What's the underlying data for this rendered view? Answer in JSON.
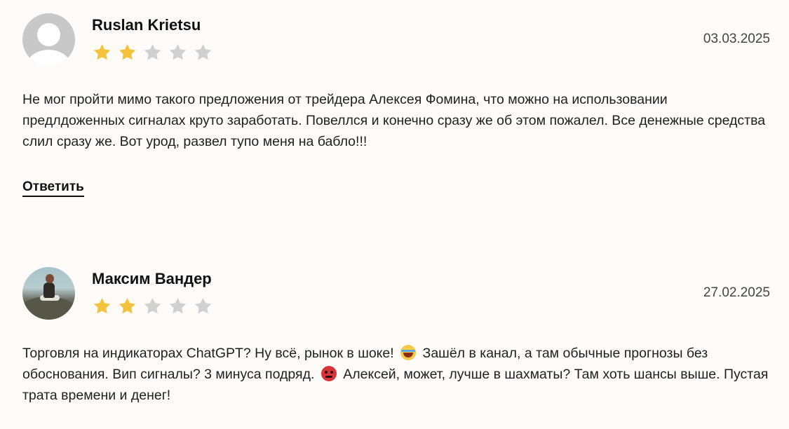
{
  "reviews": [
    {
      "author": "Ruslan Krietsu",
      "avatar": "default-user-avatar",
      "rating": 2,
      "max_rating": 5,
      "date": "03.03.2025",
      "text": "Не мог пройти мимо такого предложения от трейдера Алексея Фомина, что можно на использовании предлдоженных сигналах круто заработать. Повеллся и конечно сразу же об этом пожалел. Все денежные средства слил сразу же. Вот урод, развел тупо меня на бабло!!!",
      "reply_label": "Ответить"
    },
    {
      "author": "Максим Вандер",
      "avatar": "photo-avatar",
      "rating": 2,
      "max_rating": 5,
      "date": "27.02.2025",
      "text_parts": [
        "Торговля на индикаторах ChatGPT? Ну всё, рынок в шоке!",
        "Зашёл в канал, а там обычные прогнозы без обоснования. Вип сигналы? 3 минуса подряд.",
        "Алексей, может, лучше в шахматы? Там хоть шансы выше. Пустая трата времени и денег!"
      ],
      "emojis": [
        "laughing-emoji-icon",
        "angry-face-emoji-icon"
      ]
    }
  ],
  "colors": {
    "background": "#fffbf8",
    "star_filled": "#f5c33b",
    "star_empty": "#d0d0d0",
    "text": "#1f1f1f"
  }
}
